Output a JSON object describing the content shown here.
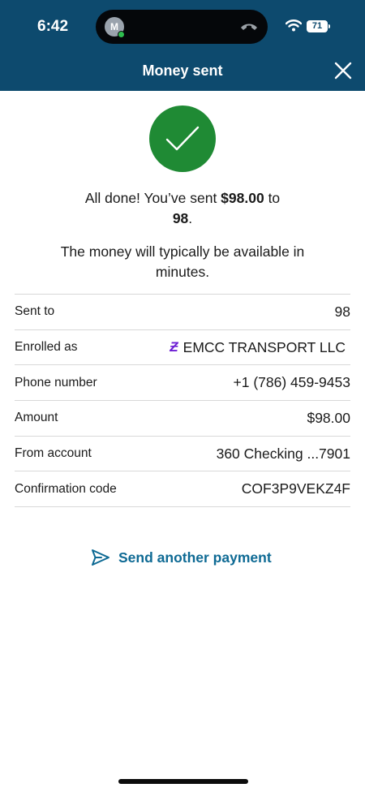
{
  "status_bar": {
    "time": "6:42",
    "contact_initial": "M",
    "battery": "71"
  },
  "header": {
    "title": "Money sent",
    "color": "#0d4a6e"
  },
  "confirmation": {
    "line1_prefix": "All done! You’ve sent ",
    "amount": "$98.00",
    "line1_suffix": " to",
    "recipient": "98",
    "line2_suffix": ".",
    "availability": "The money will typically be available in minutes."
  },
  "details": [
    {
      "label": "Sent to",
      "value": "98"
    },
    {
      "label": "Enrolled as",
      "value": "EMCC TRANSPORT LLC",
      "icon": "zelle-icon"
    },
    {
      "label": "Phone number",
      "value": "+1 (786) 459-9453"
    },
    {
      "label": "Amount",
      "value": "$98.00"
    },
    {
      "label": "From account",
      "value": "360 Checking ...7901"
    },
    {
      "label": "Confirmation code",
      "value": "COF3P9VEKZ4F"
    }
  ],
  "actions": {
    "send_another": "Send another payment"
  },
  "colors": {
    "success": "#1f8a34",
    "link": "#0e6a94",
    "zelle": "#6d1ed4"
  }
}
